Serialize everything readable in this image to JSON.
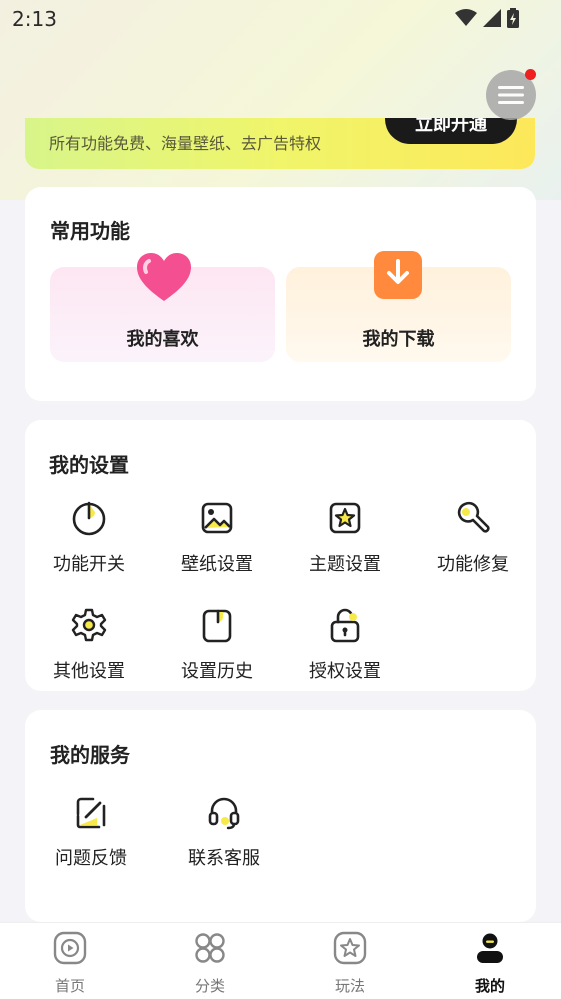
{
  "status_bar": {
    "time": "2:13"
  },
  "vip": {
    "subtitle": "所有功能免费、海量壁纸、去广告特权",
    "button_label": "立即开通"
  },
  "common": {
    "title": "常用功能",
    "items": [
      {
        "label": "我的喜欢",
        "icon": "heart-icon"
      },
      {
        "label": "我的下载",
        "icon": "download-icon"
      }
    ]
  },
  "settings": {
    "title": "我的设置",
    "items": [
      {
        "label": "功能开关",
        "icon": "power-icon"
      },
      {
        "label": "壁纸设置",
        "icon": "image-icon"
      },
      {
        "label": "主题设置",
        "icon": "theme-star-icon"
      },
      {
        "label": "功能修复",
        "icon": "wrench-icon"
      },
      {
        "label": "其他设置",
        "icon": "gear-icon"
      },
      {
        "label": "设置历史",
        "icon": "history-icon"
      },
      {
        "label": "授权设置",
        "icon": "lock-icon"
      }
    ]
  },
  "services": {
    "title": "我的服务",
    "items": [
      {
        "label": "问题反馈",
        "icon": "edit-icon"
      },
      {
        "label": "联系客服",
        "icon": "headset-icon"
      }
    ]
  },
  "tabbar": {
    "items": [
      {
        "label": "首页",
        "icon": "play-icon"
      },
      {
        "label": "分类",
        "icon": "grid-icon"
      },
      {
        "label": "玩法",
        "icon": "star-icon"
      },
      {
        "label": "我的",
        "icon": "user-icon",
        "active": true
      }
    ]
  },
  "colors": {
    "accent": "#f7e94a",
    "badge": "#f02020"
  }
}
